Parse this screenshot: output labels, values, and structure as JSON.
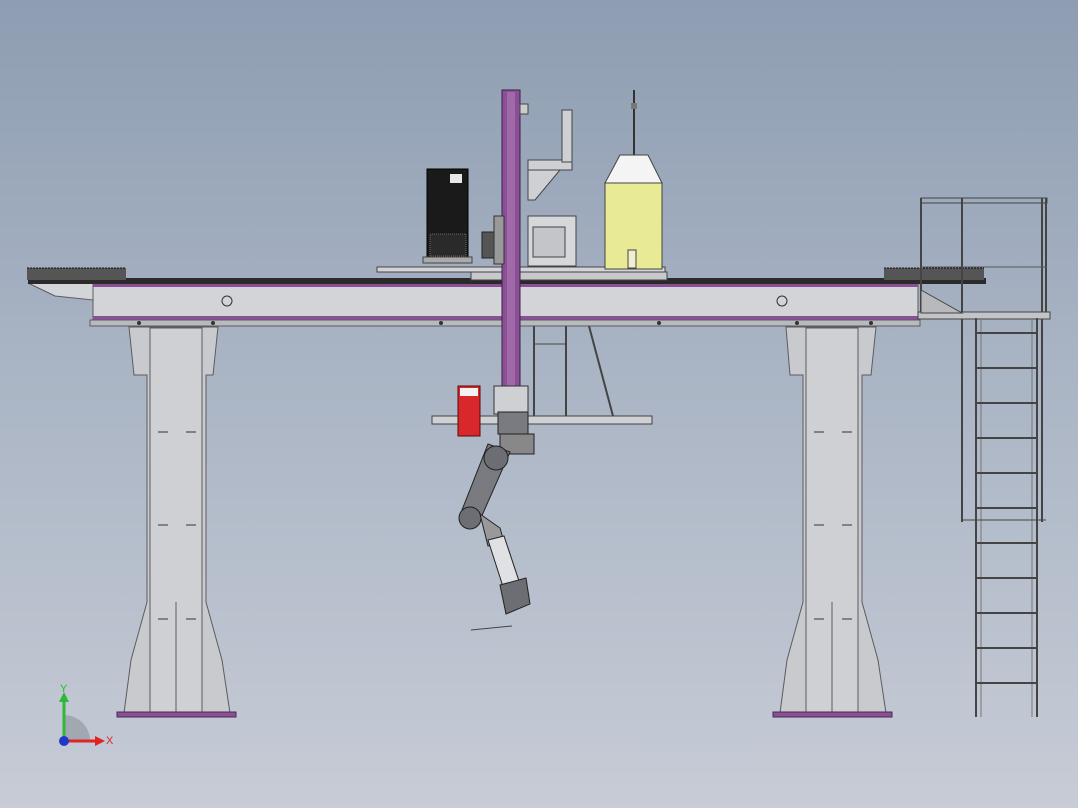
{
  "viewport": {
    "background_top": "#8e9db2",
    "background_bottom": "#c7ccd6"
  },
  "colors": {
    "structure": "#bfc0c4",
    "structure_dark": "#8e8f94",
    "purple_accent": "#8b4f96",
    "tank_yellow": "#e8ea96",
    "cabinet_black": "#1a1a1a",
    "red_unit": "#d8282c",
    "robot_grey": "#7a7b80"
  },
  "triad": {
    "y_label": "Y",
    "x_label": "X",
    "y_color": "#2eb83a",
    "x_color": "#e02424",
    "z_color": "#2238c8"
  },
  "icons": [
    "coordinate-triad-icon"
  ]
}
